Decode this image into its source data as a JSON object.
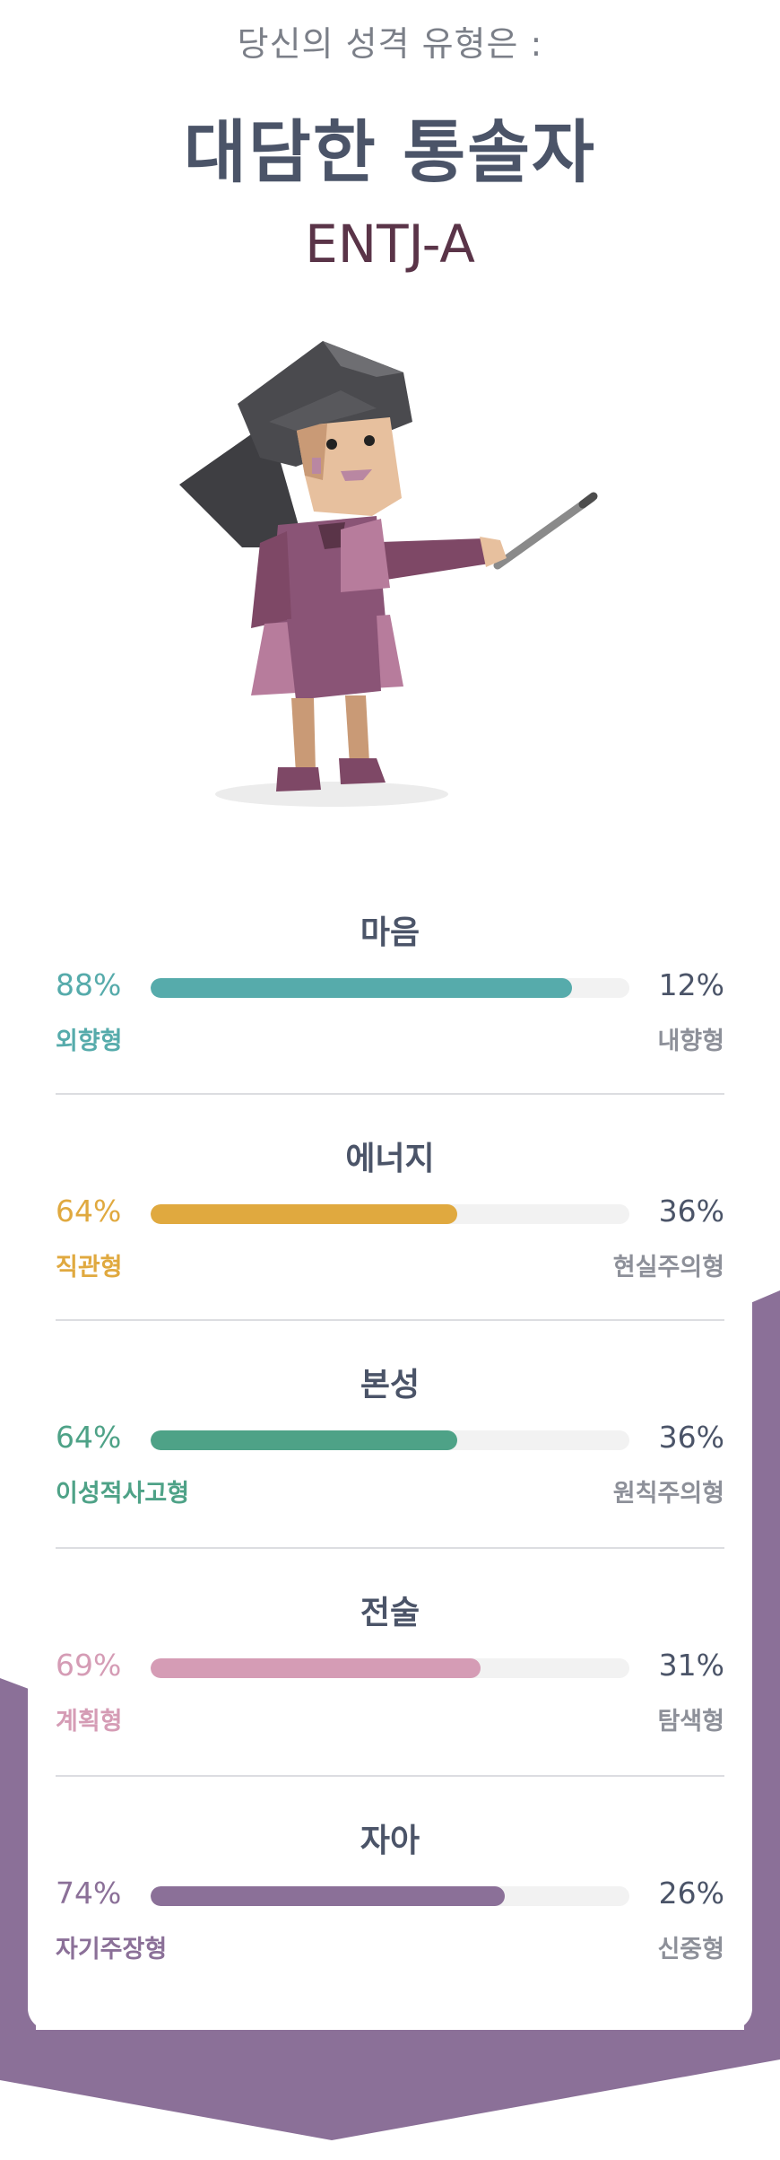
{
  "header": {
    "intro": "당신의 성격 유형은 :",
    "type_name": "대담한 통솔자",
    "type_code": "ENTJ-A"
  },
  "illustration": {
    "icon": "commander-character-illustration"
  },
  "colors": {
    "background_band": "#8b7098",
    "title": "#4b5468",
    "code": "#5a3448"
  },
  "traits": [
    {
      "title": "마음",
      "left_pct": "88%",
      "right_pct": "12%",
      "left_label": "외향형",
      "right_label": "내향형",
      "fill": 0.88,
      "color": "#56abab"
    },
    {
      "title": "에너지",
      "left_pct": "64%",
      "right_pct": "36%",
      "left_label": "직관형",
      "right_label": "현실주의형",
      "fill": 0.64,
      "color": "#e0a93f"
    },
    {
      "title": "본성",
      "left_pct": "64%",
      "right_pct": "36%",
      "left_label": "이성적사고형",
      "right_label": "원칙주의형",
      "fill": 0.64,
      "color": "#4ea287"
    },
    {
      "title": "전술",
      "left_pct": "69%",
      "right_pct": "31%",
      "left_label": "계획형",
      "right_label": "탐색형",
      "fill": 0.69,
      "color": "#d59cb5"
    },
    {
      "title": "자아",
      "left_pct": "74%",
      "right_pct": "26%",
      "left_label": "자기주장형",
      "right_label": "신중형",
      "fill": 0.74,
      "color": "#8b7098"
    }
  ]
}
